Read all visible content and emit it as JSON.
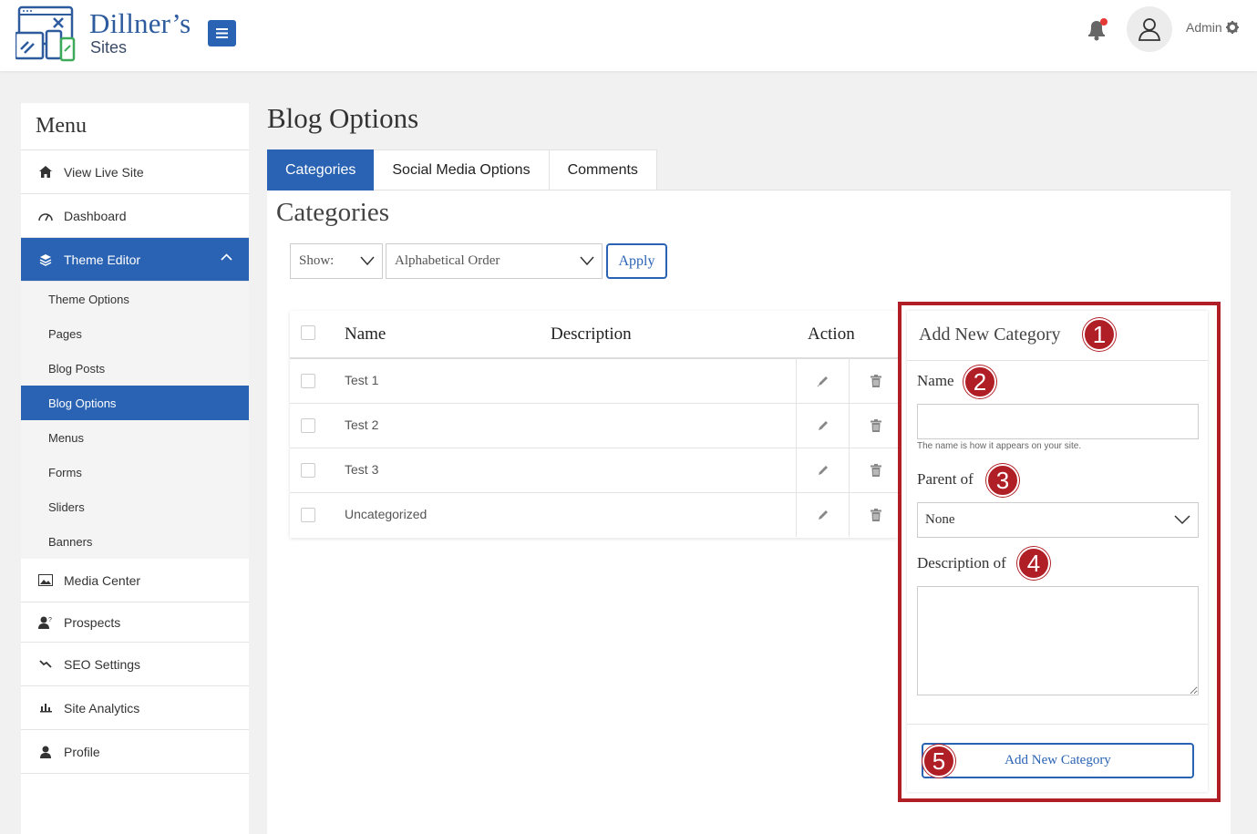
{
  "brand": {
    "name": "Dillner’s",
    "sub": "Sites"
  },
  "header": {
    "admin_label": "Admin",
    "notification_dot_color": "#e53935"
  },
  "sidebar": {
    "title": "Menu",
    "items": [
      {
        "label": "View Live Site",
        "icon": "home-icon"
      },
      {
        "label": "Dashboard",
        "icon": "dashboard-gauge-icon"
      },
      {
        "label": "Theme Editor",
        "icon": "layers-icon"
      },
      {
        "label": "Media Center",
        "icon": "image-icon"
      },
      {
        "label": "Prospects",
        "icon": "user-question-icon"
      },
      {
        "label": "SEO Settings",
        "icon": "trend-icon"
      },
      {
        "label": "Site Analytics",
        "icon": "bar-chart-icon"
      },
      {
        "label": "Profile",
        "icon": "user-icon"
      }
    ],
    "subitems": [
      "Theme Options",
      "Pages",
      "Blog Posts",
      "Blog Options",
      "Menus",
      "Forms",
      "Sliders",
      "Banners"
    ]
  },
  "main": {
    "title": "Blog Options",
    "tabs": [
      "Categories",
      "Social Media Options",
      "Comments"
    ],
    "section_title": "Categories",
    "show_label": "Show:",
    "sort_value": "Alphabetical Order",
    "apply_label": "Apply"
  },
  "table": {
    "headers": [
      "Name",
      "Description",
      "Action"
    ],
    "rows": [
      "Test 1",
      "Test 2",
      "Test 3",
      "Uncategorized"
    ]
  },
  "form": {
    "title": "Add New Category",
    "name_label": "Name",
    "name_hint": "The name is how it appears on your site.",
    "parent_label": "Parent of",
    "parent_value": "None",
    "description_label": "Description of",
    "submit_label": "Add New Category"
  },
  "callouts": [
    "1",
    "2",
    "3",
    "4",
    "5"
  ],
  "colors": {
    "accent": "#2a63b3",
    "callout": "#b11f26"
  }
}
